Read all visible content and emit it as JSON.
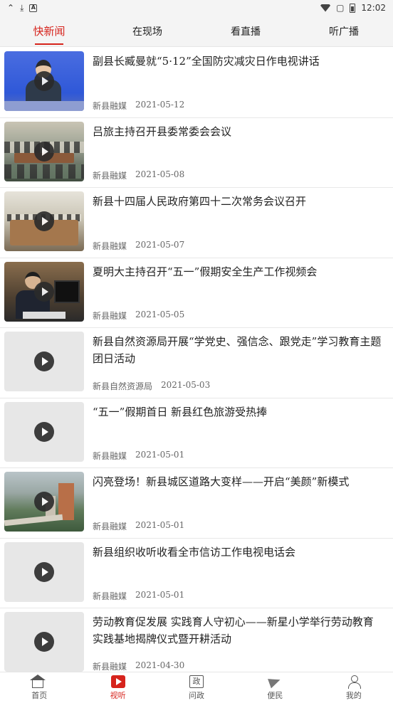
{
  "status_bar": {
    "time": "12:02",
    "left_icons": [
      "app-icon",
      "download-icon",
      "a-icon"
    ],
    "right_icons": [
      "wifi-icon",
      "no-sim-icon",
      "battery-icon"
    ]
  },
  "tabs": [
    {
      "label": "快新闻",
      "active": true
    },
    {
      "label": "在现场",
      "active": false
    },
    {
      "label": "看直播",
      "active": false
    },
    {
      "label": "听广播",
      "active": false
    }
  ],
  "news": [
    {
      "title": "副县长臧曼就“5·12”全国防灾减灾日作电视讲话",
      "source": "新县融媒",
      "date": "2021-05-12",
      "thumb": "blue"
    },
    {
      "title": "吕旅主持召开县委常委会会议",
      "source": "新县融媒",
      "date": "2021-05-08",
      "thumb": "meeting"
    },
    {
      "title": " 新县十四届人民政府第四十二次常务会议召开",
      "source": "新县融媒",
      "date": "2021-05-07",
      "thumb": "meeting2"
    },
    {
      "title": "夏明大主持召开“五一”假期安全生产工作视频会",
      "source": "新县融媒",
      "date": "2021-05-05",
      "thumb": "office"
    },
    {
      "title": "新县自然资源局开展“学党史、强信念、跟党走”学习教育主题团日活动",
      "source": "新县自然资源局",
      "date": "2021-05-03",
      "thumb": "plain"
    },
    {
      "title": "“五一”假期首日 新县红色旅游受热捧",
      "source": "新县融媒",
      "date": "2021-05-01",
      "thumb": "plain"
    },
    {
      "title": "闪亮登场！新县城区道路大变样——开启“美颜”新模式",
      "source": "新县融媒",
      "date": "2021-05-01",
      "thumb": "city"
    },
    {
      "title": "新县组织收听收看全市信访工作电视电话会",
      "source": "新县融媒",
      "date": "2021-05-01",
      "thumb": "plain"
    },
    {
      "title": "劳动教育促发展 实践育人守初心——新星小学举行劳动教育实践基地揭牌仪式暨开耕活动",
      "source": "新县融媒",
      "date": "2021-04-30",
      "thumb": "plain"
    }
  ],
  "bottom_nav": [
    {
      "label": "首页",
      "icon": "home-icon",
      "active": false
    },
    {
      "label": "视听",
      "icon": "video-icon",
      "active": true
    },
    {
      "label": "问政",
      "icon": "zheng-icon",
      "active": false
    },
    {
      "label": "便民",
      "icon": "send-icon",
      "active": false
    },
    {
      "label": "我的",
      "icon": "user-icon",
      "active": false
    }
  ],
  "colors": {
    "accent": "#d6231c",
    "tab_bg": "#f4f4f4"
  }
}
